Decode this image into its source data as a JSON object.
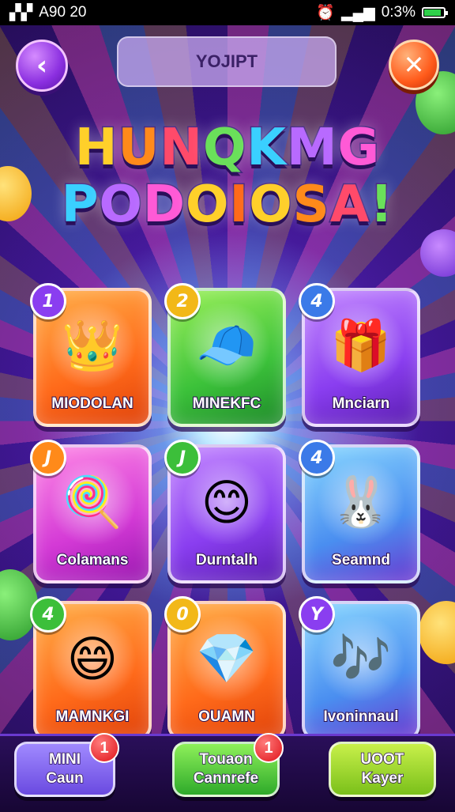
{
  "status_bar": {
    "time": "A90 20",
    "left_icons": "signal-glyph-icon",
    "battery_text": "0:3%"
  },
  "header": {
    "title": "YOJIPT",
    "back_icon": "chevron-left-icon",
    "close_icon": "close-icon"
  },
  "logo": {
    "line1": "HUNQKMG",
    "line2": "PODOIOSA!"
  },
  "cards": [
    {
      "num": "1",
      "label": "MIODOLAN",
      "icon": "crowned-girl-icon",
      "color": "orange"
    },
    {
      "num": "2",
      "label": "MINEKFC",
      "icon": "red-cap-kid-icon",
      "color": "green"
    },
    {
      "num": "4",
      "label": "Mnciarn",
      "icon": "treasure-box-icon",
      "color": "purple"
    },
    {
      "num": "J",
      "label": "Colamans",
      "icon": "swirl-candy-icon",
      "color": "pink"
    },
    {
      "num": "J",
      "label": "Durntalh",
      "icon": "blonde-kid-icon",
      "color": "purple"
    },
    {
      "num": "4",
      "label": "Seamnd",
      "icon": "bunny-hat-kid-icon",
      "color": "blue"
    },
    {
      "num": "4",
      "label": "MAMNKGI",
      "icon": "red-hair-kid-icon",
      "color": "orange"
    },
    {
      "num": "0",
      "label": "OUAMN",
      "icon": "rainbow-gem-icon",
      "color": "orange"
    },
    {
      "num": "Y",
      "label": "Ivoninnaul",
      "icon": "music-box-icon",
      "color": "blue"
    }
  ],
  "bottom_buttons": [
    {
      "line1": "MINI",
      "line2": "Caun",
      "badge": "1"
    },
    {
      "line1": "Touaon",
      "line2": "Cannrefe",
      "badge": "1"
    },
    {
      "line1": "UOOT",
      "line2": "Kayer",
      "badge": ""
    }
  ]
}
